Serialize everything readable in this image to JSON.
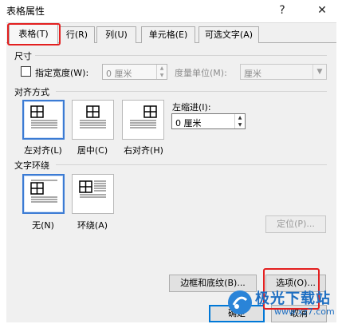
{
  "window": {
    "title": "表格属性",
    "help_label": "?",
    "close_label": "✕"
  },
  "tabs": [
    {
      "label": "表格(T)",
      "active": true
    },
    {
      "label": "行(R)"
    },
    {
      "label": "列(U)"
    },
    {
      "label": "单元格(E)"
    },
    {
      "label": "可选文字(A)"
    }
  ],
  "size": {
    "group_label": "尺寸",
    "preferred_width_label": "指定宽度(W):",
    "preferred_width_value": "0 厘米",
    "measure_label": "度量单位(M):",
    "measure_value": "厘米"
  },
  "alignment": {
    "group_label": "对齐方式",
    "options": [
      {
        "label": "左对齐(L)",
        "selected": true
      },
      {
        "label": "居中(C)"
      },
      {
        "label": "右对齐(H)"
      }
    ],
    "indent_label": "左缩进(I):",
    "indent_value": "0 厘米"
  },
  "wrapping": {
    "group_label": "文字环绕",
    "options": [
      {
        "label": "无(N)",
        "selected": true
      },
      {
        "label": "环绕(A)"
      }
    ],
    "position_button": "定位(P)..."
  },
  "buttons": {
    "borders_shading": "边框和底纹(B)...",
    "options": "选项(O)...",
    "ok": "确定",
    "cancel": "取消"
  },
  "watermark": {
    "text": "极光下载站",
    "url": "www.xz7.com"
  },
  "colors": {
    "highlight_red": "#e31f1f",
    "selection_blue": "#3b7bd4"
  }
}
